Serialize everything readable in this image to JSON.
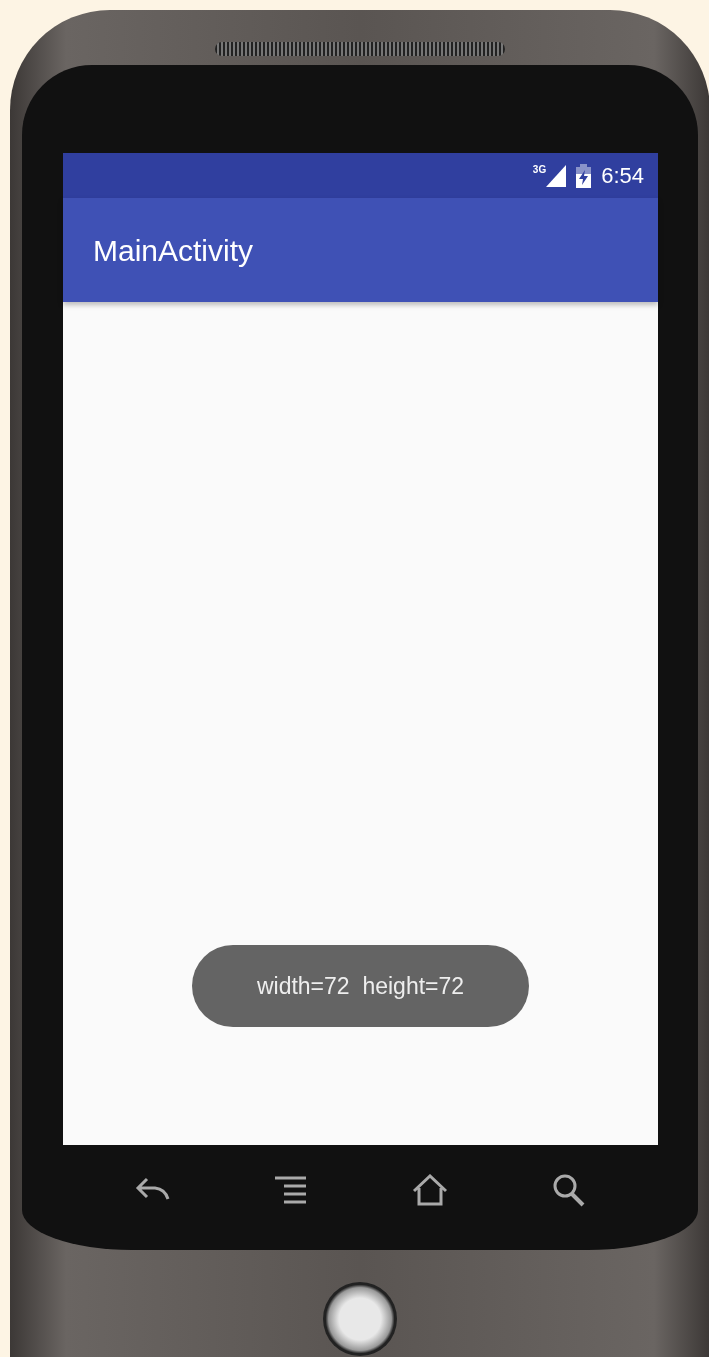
{
  "status_bar": {
    "network": "3G",
    "time": "6:54"
  },
  "app_bar": {
    "title": "MainActivity"
  },
  "toast": {
    "text": "width=72  height=72"
  }
}
